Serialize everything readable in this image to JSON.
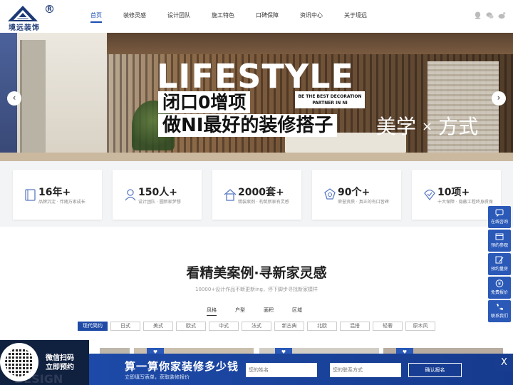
{
  "logo": {
    "text": "境远装饰",
    "reg": "R"
  },
  "nav": [
    {
      "label": "首页",
      "active": true
    },
    {
      "label": "装修灵感"
    },
    {
      "label": "设计团队"
    },
    {
      "label": "施工特色"
    },
    {
      "label": "口碑保障"
    },
    {
      "label": "资讯中心"
    },
    {
      "label": "关于境远"
    }
  ],
  "header_icons": [
    "qq-icon",
    "wechat-icon",
    "weibo-icon"
  ],
  "banner": {
    "lifestyle": "LIFESTYLE",
    "headline1": "闭口0增项",
    "headline2": "做NI最好的装修搭子",
    "partner": "BE THE BEST DECORATION PARTNER IN NI",
    "aesthetic_left": "美学",
    "aesthetic_x": "×",
    "aesthetic_right": "方式",
    "prev": "‹",
    "next": "›"
  },
  "stats": [
    {
      "num": "16年+",
      "desc": "品牌沉淀 · 伴随万家成长",
      "icon": "book-icon"
    },
    {
      "num": "150人+",
      "desc": "设计团队 · 圆新家梦想",
      "icon": "user-icon"
    },
    {
      "num": "2000套+",
      "desc": "精装案例 · 构筑新家有灵感",
      "icon": "house-icon"
    },
    {
      "num": "90个+",
      "desc": "荣誉资质 · 真正的有口皆碑",
      "icon": "medal-icon"
    },
    {
      "num": "10项+",
      "desc": "十大保障 · 隐蔽工程终身质保",
      "icon": "shield-icon"
    }
  ],
  "cases": {
    "title": "看精美案例·寻新家灵感",
    "subtitle": "10000+设计作品不断更新ing，停下脚步寻找新家模样",
    "tabs": [
      "风格",
      "户型",
      "面积",
      "区域"
    ],
    "styles": [
      "现代简约",
      "日式",
      "美式",
      "欧式",
      "中式",
      "法式",
      "新古典",
      "北欧",
      "混搭",
      "轻奢",
      "原木风"
    ]
  },
  "side": [
    {
      "label": "在线咨询",
      "icon": "chat-icon"
    },
    {
      "label": "预约参观",
      "icon": "calendar-icon"
    },
    {
      "label": "预约量房",
      "icon": "edit-icon"
    },
    {
      "label": "免费报价",
      "icon": "yen-icon"
    },
    {
      "label": "联系我们",
      "icon": "phone-icon"
    }
  ],
  "bottom": {
    "qr_line1": "微信扫码",
    "qr_line2": "立即预约",
    "bg_text": "DESIGN",
    "calc_title": "算一算你家装修多少钱",
    "calc_sub": "立即填写表单，获取装修报价",
    "name_placeholder": "您的姓名",
    "phone_placeholder": "您的联系方式",
    "submit": "确认报名",
    "close": "X"
  },
  "colors": {
    "brand": "#1d3a77",
    "accent": "#1f4aa6"
  }
}
